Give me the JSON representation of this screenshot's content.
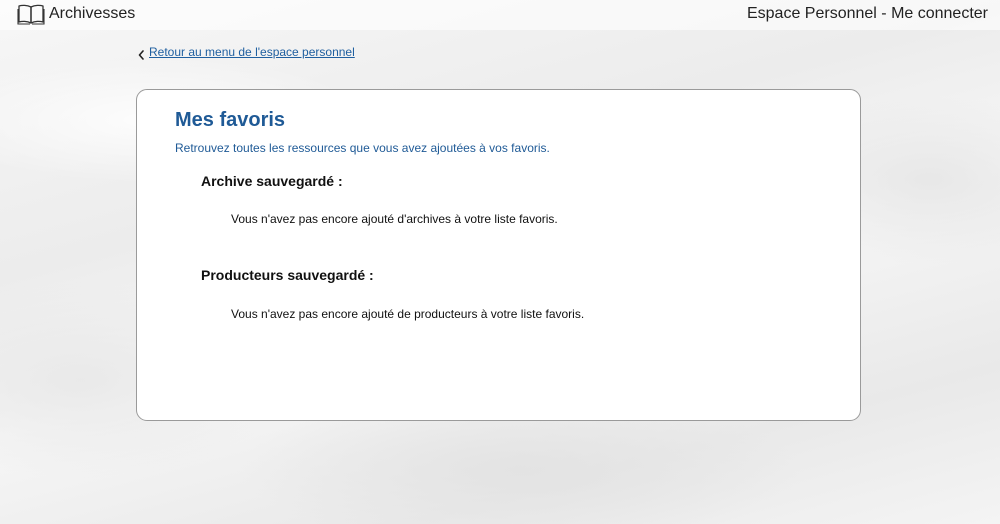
{
  "header": {
    "brand_name": "Archivesses",
    "brand_icon": "open-book-icon",
    "account_link": "Espace Personnel - Me connecter"
  },
  "back_link": {
    "icon": "chevron-left-icon",
    "label": "Retour au menu de l'espace personnel"
  },
  "favorites": {
    "title": "Mes favoris",
    "subtitle": "Retrouvez toutes les ressources que vous avez ajoutées à vos favoris.",
    "sections": [
      {
        "heading": "Archive sauvegardé :",
        "empty_message": "Vous n'avez pas encore ajouté d'archives à votre liste favoris."
      },
      {
        "heading": "Producteurs sauvegardé :",
        "empty_message": "Vous n'avez pas encore ajouté de producteurs à votre liste favoris."
      }
    ]
  },
  "colors": {
    "link_blue": "#1f5fa0",
    "title_blue": "#1f5a96"
  }
}
